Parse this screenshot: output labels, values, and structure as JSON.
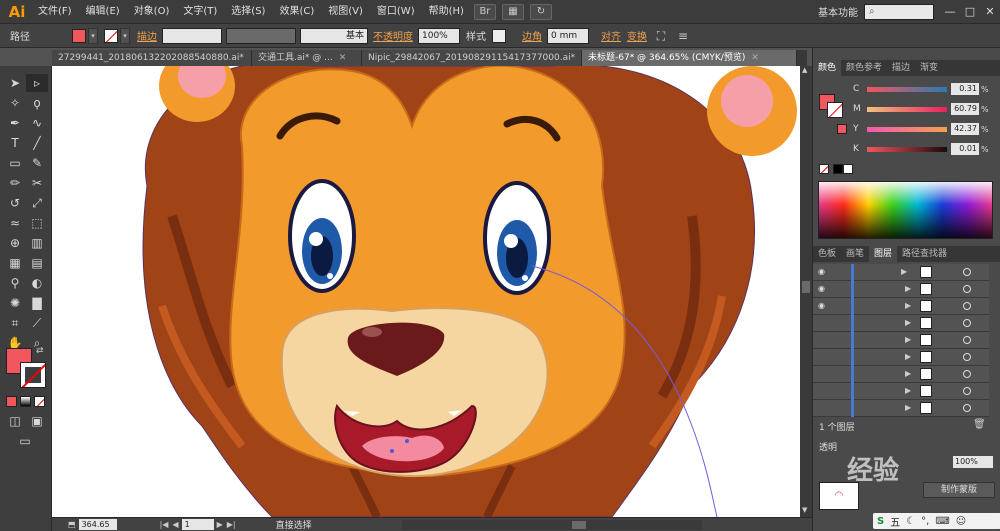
{
  "app": {
    "logo": "Ai",
    "workspace": "基本功能",
    "search_placeholder": ""
  },
  "menu": [
    "文件(F)",
    "编辑(E)",
    "对象(O)",
    "文字(T)",
    "选择(S)",
    "效果(C)",
    "视图(V)",
    "窗口(W)",
    "帮助(H)"
  ],
  "window_buttons": [
    "—",
    "□",
    "✕"
  ],
  "control_bar": {
    "selection_label": "路径",
    "stroke_label": "描边",
    "stroke_style": "基本",
    "opacity_label": "不透明度",
    "opacity_value": "100%",
    "style_label": "样式",
    "corner_label": "边角",
    "corner_value": "0 mm",
    "align_label": "对齐",
    "transform_label": "变换",
    "fill_color": "#f2575e"
  },
  "tabs": [
    {
      "label": "27299441_201806132202088540880.ai*",
      "active": false
    },
    {
      "label": "交通工具.ai* @ ...",
      "active": false
    },
    {
      "label": "Nipic_29842067_20190829115417377000.ai*",
      "active": false
    },
    {
      "label": "未标题-67* @ 364.65% (CMYK/预览)",
      "active": true
    }
  ],
  "status": {
    "zoom": "364.65",
    "artboard": "1",
    "tool_name": "直接选择"
  },
  "color_panel": {
    "tabs": [
      "颜色",
      "颜色参考",
      "描边",
      "渐变"
    ],
    "channels": [
      {
        "label": "C",
        "value": "0.31",
        "unit": "%"
      },
      {
        "label": "M",
        "value": "60.79",
        "unit": "%"
      },
      {
        "label": "Y",
        "value": "42.37",
        "unit": "%"
      },
      {
        "label": "K",
        "value": "0.01",
        "unit": "%"
      }
    ]
  },
  "layers_panel": {
    "tabs": [
      "色板",
      "画笔",
      "图层",
      "路径查找器"
    ],
    "count_label": "1 个图层",
    "rows": 9
  },
  "bottom_panel": {
    "label": "透明",
    "opacity_value": "100%",
    "button_label": "制作蒙版"
  },
  "watermark": "经验"
}
